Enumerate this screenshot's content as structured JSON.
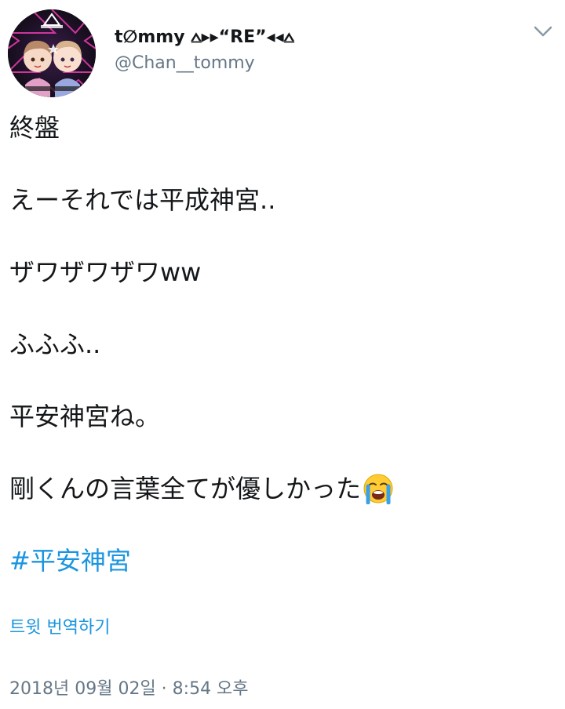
{
  "user": {
    "display_name": "t∅mmy ⩟▸▸“RE”◂◂⩟",
    "handle": "@Chan__tommy",
    "avatar_icon": "profile-avatar-image"
  },
  "menu": {
    "icon": "chevron-down-icon"
  },
  "tweet": {
    "lines": [
      "終盤",
      "えーそれでは平成神宮..",
      "ザワザワザワww",
      "ふふふ..",
      "平安神宮ね。",
      "剛くんの言葉全てが優しかった"
    ],
    "emoji": "loudly-crying-face",
    "hashtag": "#平安神宮"
  },
  "translate_label": "트윗 번역하기",
  "timestamp": "2018년 09월 02일 · 8:54 오후",
  "colors": {
    "link": "#1b95e0",
    "secondary": "#657786",
    "text": "#14171a"
  }
}
